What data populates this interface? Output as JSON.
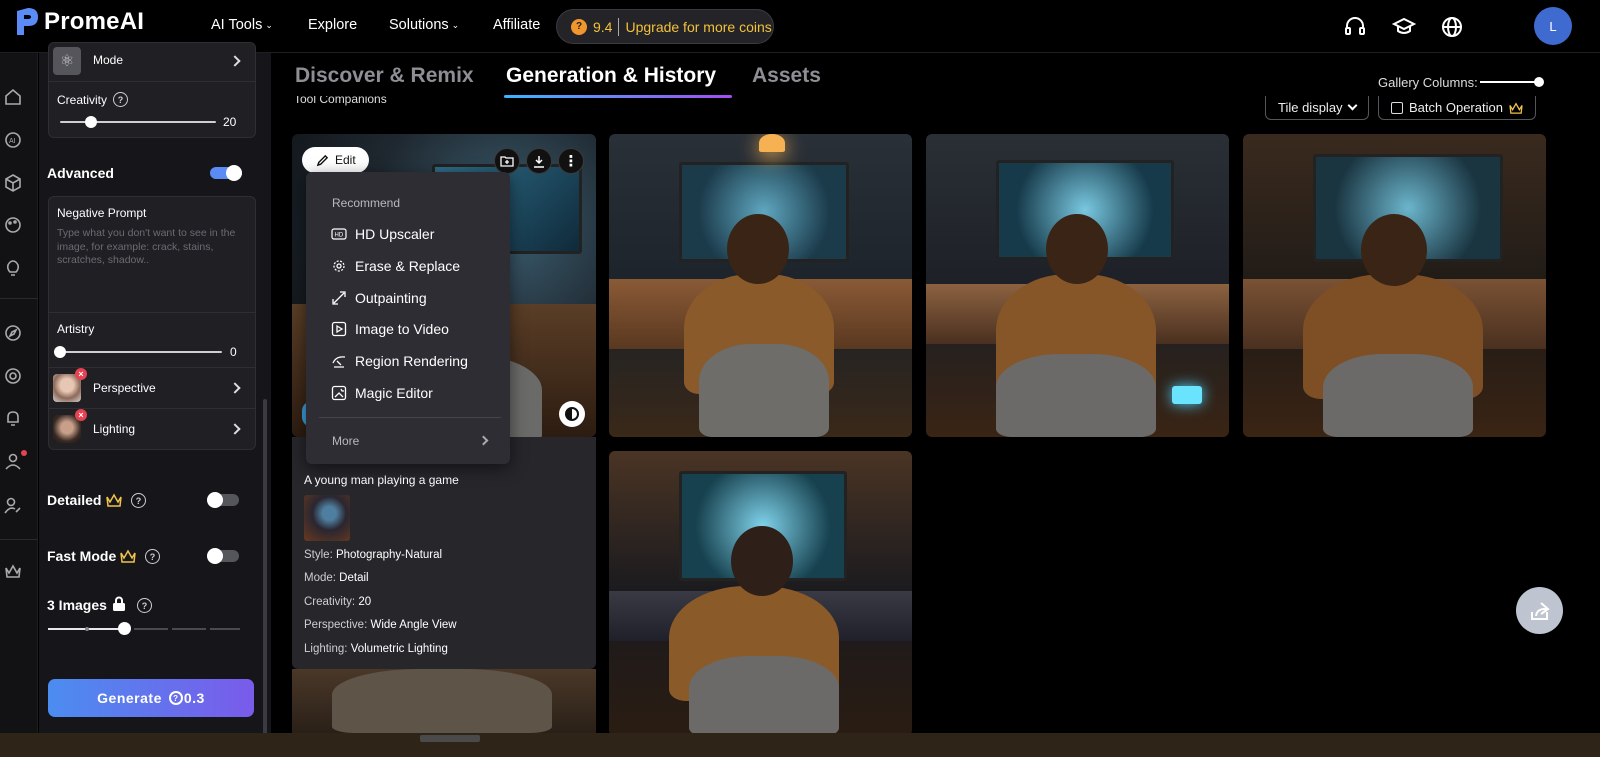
{
  "app": {
    "name": "PromeAI"
  },
  "nav": {
    "items": [
      {
        "label": "AI Tools",
        "has_caret": true
      },
      {
        "label": "Explore",
        "has_caret": false
      },
      {
        "label": "Solutions",
        "has_caret": true
      },
      {
        "label": "Affiliate",
        "has_caret": false
      }
    ],
    "coins": {
      "value": "9.4",
      "upgrade_label": "Upgrade for more coins"
    },
    "avatar_initial": "L"
  },
  "panel": {
    "mode_label": "Mode",
    "creativity": {
      "label": "Creativity",
      "value": "20",
      "fraction": 0.2
    },
    "advanced": {
      "label": "Advanced",
      "on": true
    },
    "negative_prompt": {
      "label": "Negative Prompt",
      "placeholder": "Type what you don't want to see in the image, for example: crack, stains, scratches, shadow.."
    },
    "artistry": {
      "label": "Artistry",
      "value": "0",
      "fraction": 0.0
    },
    "perspective_label": "Perspective",
    "lighting_label": "Lighting",
    "detailed": {
      "label": "Detailed",
      "on": false
    },
    "fast_mode": {
      "label": "Fast Mode",
      "on": false
    },
    "images": {
      "label": "3 Images"
    },
    "generate": {
      "label": "Generate",
      "cost": "0.3"
    }
  },
  "tabs": [
    {
      "label": "Discover & Remix",
      "active": false
    },
    {
      "label": "Generation & History",
      "active": true
    },
    {
      "label": "Assets",
      "active": false
    }
  ],
  "gallery": {
    "columns_label": "Gallery Columns:",
    "tile_display_label": "Tile display",
    "batch_label": "Batch Operation",
    "sub_text": "Tool Companions"
  },
  "card_menu": {
    "edit_label": "Edit",
    "recommend_label": "Recommend",
    "items": [
      {
        "label": "HD Upscaler",
        "icon": "hd-icon"
      },
      {
        "label": "Erase & Replace",
        "icon": "erase-icon"
      },
      {
        "label": "Outpainting",
        "icon": "outpaint-icon"
      },
      {
        "label": "Image to Video",
        "icon": "video-icon"
      },
      {
        "label": "Region Rendering",
        "icon": "region-icon"
      },
      {
        "label": "Magic Editor",
        "icon": "magic-icon"
      }
    ],
    "more_label": "More"
  },
  "details": {
    "prompt": "A young man playing a game",
    "style_label": "Style:",
    "style_value": "Photography-Natural",
    "mode_label": "Mode:",
    "mode_value": "Detail",
    "creativity_label": "Creativity:",
    "creativity_value": "20",
    "perspective_label": "Perspective:",
    "perspective_value": "Wide Angle View",
    "lighting_label": "Lighting:",
    "lighting_value": "Volumetric Lighting"
  }
}
